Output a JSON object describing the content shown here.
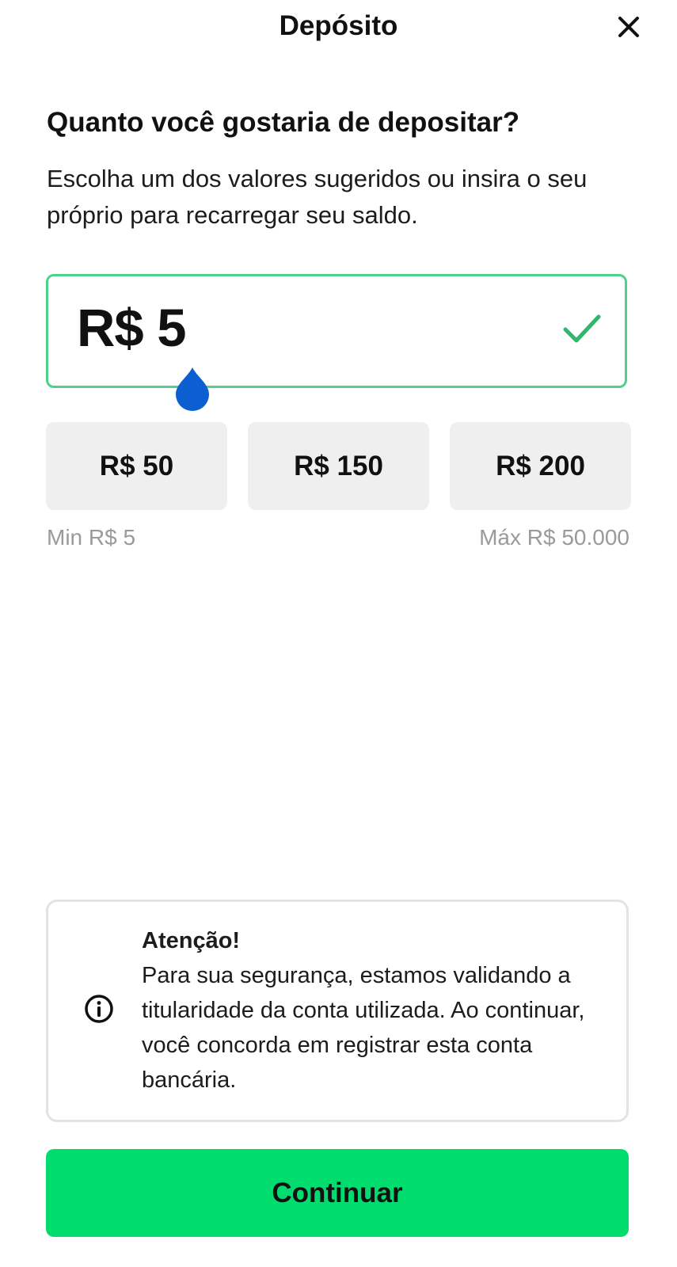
{
  "header": {
    "title": "Depósito",
    "close_icon": "close-icon"
  },
  "main": {
    "heading": "Quanto você gostaria de depositar?",
    "subtitle": "Escolha um dos valores sugeridos ou insira o seu próprio para recarregar seu saldo.",
    "amount": {
      "value": "R$ 5",
      "valid_icon": "check-icon",
      "handle_icon": "drag-handle"
    },
    "suggested_amounts": [
      "R$ 50",
      "R$ 150",
      "R$ 200"
    ],
    "limits": {
      "min": "Min R$ 5",
      "max": "Máx R$ 50.000"
    }
  },
  "notice": {
    "icon": "info-icon",
    "title": "Atenção!",
    "body": "Para sua segurança, estamos validando a titularidade da conta utilizada. Ao continuar, você concorda em registrar esta conta bancária."
  },
  "footer": {
    "continue_label": "Continuar"
  },
  "colors": {
    "accent": "#00dd6e",
    "field_border": "#4fd18b",
    "check": "#2fb86b",
    "handle": "#0b5fd1",
    "chip_bg": "#efefef",
    "muted_text": "#9a9a9a"
  }
}
